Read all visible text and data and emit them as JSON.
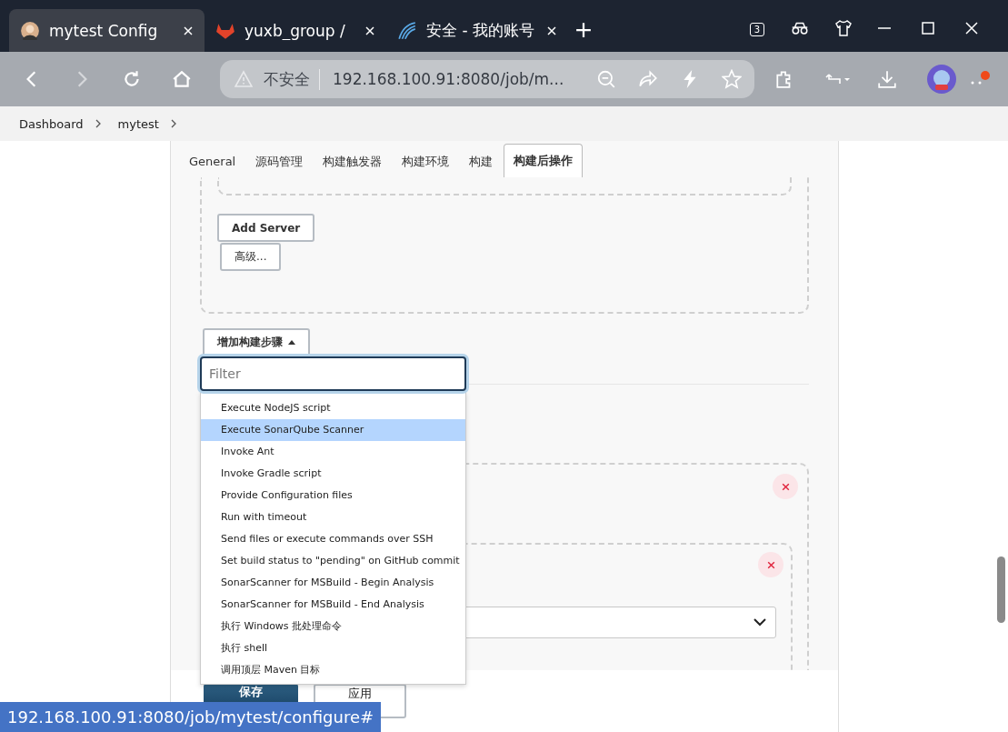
{
  "browser": {
    "tabs": [
      {
        "title": "mytest Config",
        "selected": true
      },
      {
        "title": "yuxb_group /",
        "selected": false
      },
      {
        "title": "安全 - 我的账号",
        "selected": false
      }
    ],
    "tab_count": "3",
    "security_label": "不安全",
    "url": "192.168.100.91:8080/job/m..."
  },
  "breadcrumb": [
    "Dashboard",
    "mytest"
  ],
  "config_tabs": [
    {
      "label": "General",
      "selected": false
    },
    {
      "label": "源码管理",
      "selected": false
    },
    {
      "label": "构建触发器",
      "selected": false
    },
    {
      "label": "构建环境",
      "selected": false
    },
    {
      "label": "构建",
      "selected": false
    },
    {
      "label": "构建后操作",
      "selected": true
    }
  ],
  "buttons": {
    "add_server": "Add Server",
    "advanced": "高级...",
    "add_build_step": "增加构建步骤"
  },
  "filter": {
    "placeholder": "Filter"
  },
  "step_menu": [
    {
      "label": "Execute NodeJS script",
      "selected": false
    },
    {
      "label": "Execute SonarQube Scanner",
      "selected": true
    },
    {
      "label": "Invoke Ant",
      "selected": false
    },
    {
      "label": "Invoke Gradle script",
      "selected": false
    },
    {
      "label": "Provide Configuration files",
      "selected": false
    },
    {
      "label": "Run with timeout",
      "selected": false
    },
    {
      "label": "Send files or execute commands over SSH",
      "selected": false
    },
    {
      "label": "Set build status to \"pending\" on GitHub commit",
      "selected": false
    },
    {
      "label": "SonarScanner for MSBuild - Begin Analysis",
      "selected": false
    },
    {
      "label": "SonarScanner for MSBuild - End Analysis",
      "selected": false
    },
    {
      "label": "执行 Windows 批处理命令",
      "selected": false
    },
    {
      "label": "执行 shell",
      "selected": false
    },
    {
      "label": "调用顶层 Maven 目标",
      "selected": false
    }
  ],
  "footer": {
    "save": "保存",
    "apply": "应用"
  },
  "status_bar": "192.168.100.91:8080/job/mytest/configure#"
}
